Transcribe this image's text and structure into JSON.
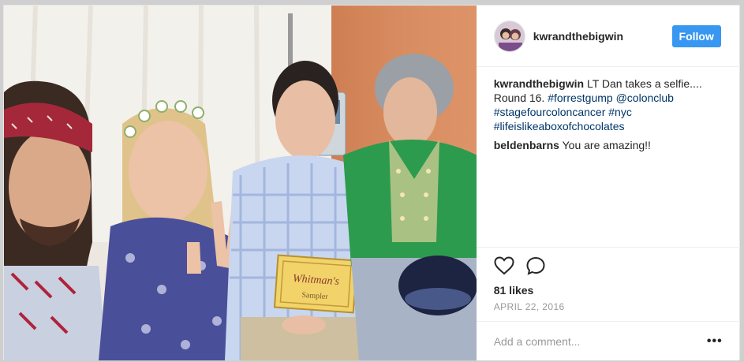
{
  "post": {
    "username": "kwrandthebigwin",
    "follow_label": "Follow",
    "caption": {
      "username": "kwrandthebigwin",
      "text": "LT Dan takes a selfie.... Round 16.",
      "tags": [
        "#forrestgump",
        "@colonclub",
        "#stagefourcoloncancer",
        "#nyc",
        "#lifeislikeaboxofchocolates"
      ]
    },
    "comments": [
      {
        "username": "beldenbarns",
        "text": "You are amazing!!"
      }
    ],
    "icons": {
      "like": "heart-icon",
      "comment": "comment-icon",
      "more": "more-options-icon"
    },
    "likes": "81 likes",
    "date": "APRIL 22, 2016",
    "add_comment_placeholder": "Add a comment...",
    "more_label": "•••",
    "photo": {
      "box_text": "Whitman's",
      "box_subtext": "Sampler"
    }
  }
}
